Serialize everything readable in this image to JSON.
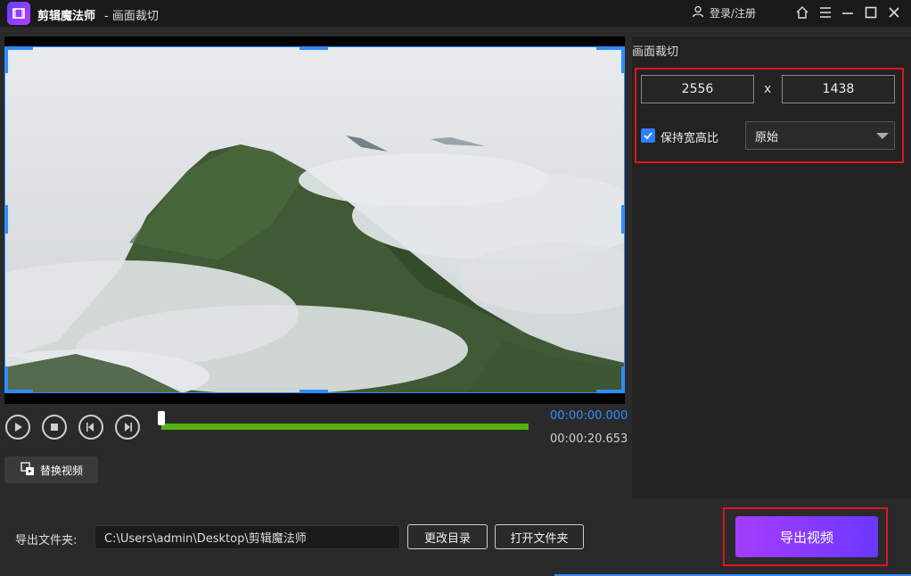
{
  "titlebar": {
    "app_name": "剪辑魔法师",
    "window_title": "- 画面裁切",
    "login_label": "登录/注册"
  },
  "player": {
    "current_time": "00:00:00.000",
    "duration": "00:00:20.653",
    "progress": 0,
    "replace_video_label": "替换视频"
  },
  "crop_panel": {
    "title": "画面裁切",
    "width": "2556",
    "separator": "x",
    "height": "1438",
    "keep_ratio_label": "保持宽高比",
    "keep_ratio_checked": true,
    "ratio_selected": "原始"
  },
  "export": {
    "folder_label": "导出文件夹:",
    "folder_path": "C:\\Users\\admin\\Desktop\\剪辑魔法师",
    "change_dir_label": "更改目录",
    "open_folder_label": "打开文件夹",
    "export_button_label": "导出视频"
  },
  "colors": {
    "accent_blue": "#2f8cff",
    "highlight_red": "#e0141e",
    "progress_green": "#55b30f",
    "export_gradient_start": "#a53cff",
    "export_gradient_end": "#6a38ff"
  }
}
